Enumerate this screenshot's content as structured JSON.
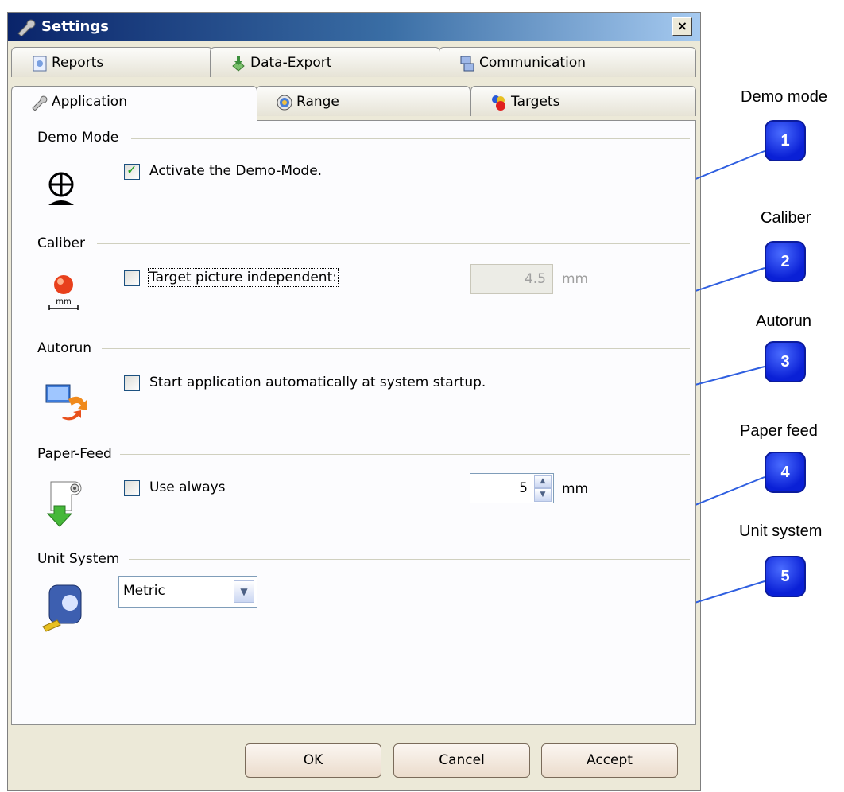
{
  "window": {
    "title": "Settings",
    "close_label": "×"
  },
  "tabs_row1": [
    {
      "label": "Reports"
    },
    {
      "label": "Data-Export"
    },
    {
      "label": "Communication"
    }
  ],
  "tabs_row2": [
    {
      "label": "Application",
      "active": true
    },
    {
      "label": "Range"
    },
    {
      "label": "Targets"
    }
  ],
  "groups": {
    "demo": {
      "label": "Demo Mode",
      "checkbox_label": "Activate the Demo-Mode.",
      "checked": true
    },
    "caliber": {
      "label": "Caliber",
      "checkbox_label": "Target picture independent:",
      "checked": false,
      "value": "4.5",
      "unit": "mm"
    },
    "autorun": {
      "label": "Autorun",
      "checkbox_label": "Start application automatically at system startup.",
      "checked": false
    },
    "paper": {
      "label": "Paper-Feed",
      "checkbox_label": "Use always",
      "checked": false,
      "value": "5",
      "unit": "mm"
    },
    "units": {
      "label": "Unit System",
      "selected": "Metric"
    }
  },
  "buttons": {
    "ok": "OK",
    "cancel": "Cancel",
    "accept": "Accept"
  },
  "annotations": [
    {
      "title": "Demo mode",
      "number": "1"
    },
    {
      "title": "Caliber",
      "number": "2"
    },
    {
      "title": "Autorun",
      "number": "3"
    },
    {
      "title": "Paper feed",
      "number": "4"
    },
    {
      "title": "Unit system",
      "number": "5"
    }
  ],
  "colors": {
    "badge": "#0a20d6",
    "callout_line": "#2f5fe0",
    "titlebar": "#0a246a"
  },
  "icons": {
    "title": "wrench-icon",
    "reports": "report-icon",
    "export": "export-icon",
    "communication": "computer-network-icon",
    "application": "wrench-icon",
    "range": "target-range-icon",
    "targets": "targets-icon",
    "demo": "demo-target-icon",
    "caliber": "caliber-ball-icon",
    "autorun": "autorun-icon",
    "paper": "paper-feed-icon",
    "units": "measuring-tape-icon"
  }
}
